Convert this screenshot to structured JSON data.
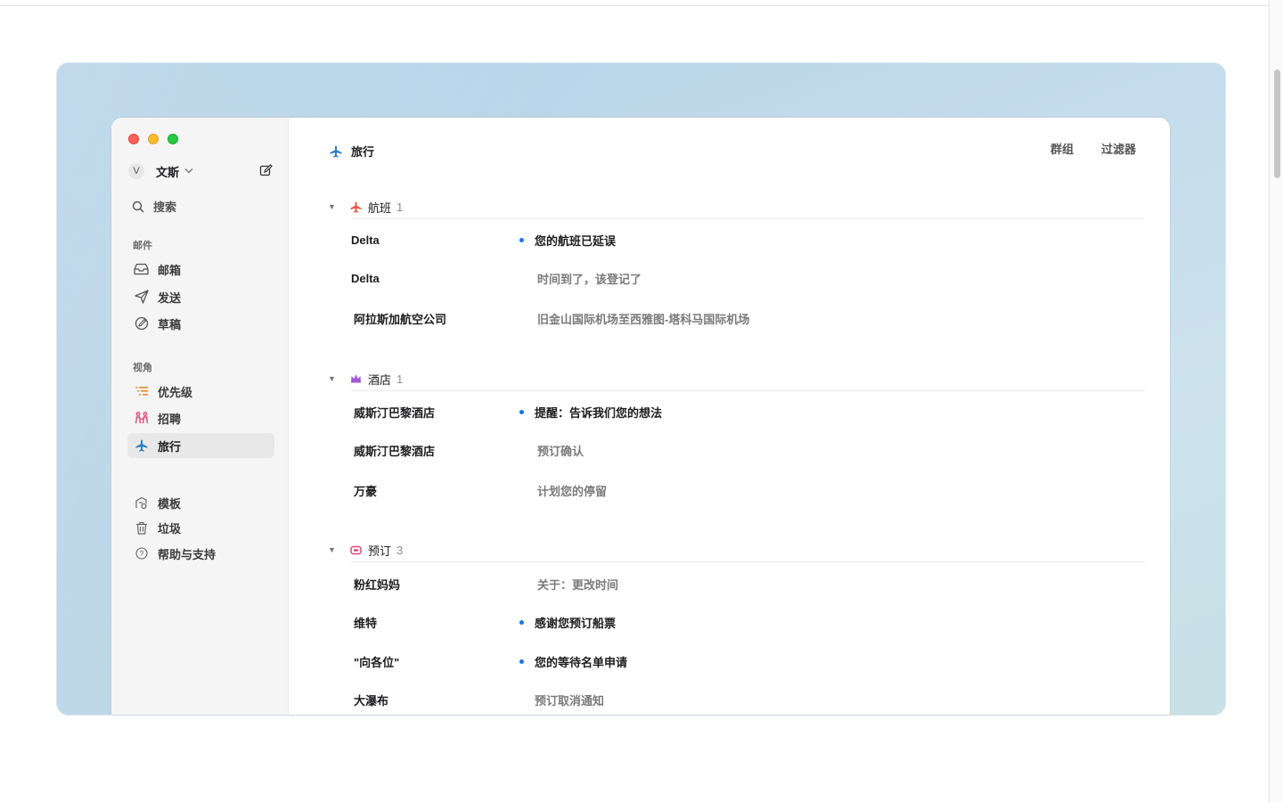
{
  "sidebar": {
    "account": {
      "initial": "V",
      "name": "文斯"
    },
    "search_label": "搜索",
    "mail_section": "邮件",
    "mail_items": [
      {
        "label": "邮箱",
        "icon": "inbox-icon"
      },
      {
        "label": "发送",
        "icon": "send-icon"
      },
      {
        "label": "草稿",
        "icon": "draft-icon"
      }
    ],
    "views_section": "视角",
    "view_items": [
      {
        "label": "优先级",
        "icon": "priority-list-icon"
      },
      {
        "label": "招聘",
        "icon": "people-icon"
      },
      {
        "label": "旅行",
        "icon": "airplane-icon",
        "active": true
      }
    ],
    "bottom_items": [
      {
        "label": "模板",
        "icon": "template-icon"
      },
      {
        "label": "垃圾",
        "icon": "trash-icon"
      },
      {
        "label": "帮助与支持",
        "icon": "help-icon"
      }
    ]
  },
  "main": {
    "title": "旅行",
    "group_button": "群组",
    "filter_button": "过滤器",
    "groups": [
      {
        "name": "航班",
        "count": "1",
        "icon": "airplane-icon",
        "color": "#e8503a",
        "rows": [
          {
            "sender": "Delta",
            "subject": "您的航班已延误",
            "unread": true
          },
          {
            "sender": "Delta",
            "subject": "时间到了，该登记了",
            "unread": false
          },
          {
            "sender": "阿拉斯加航空公司",
            "subject": "旧金山国际机场至西雅图-塔科马国际机场",
            "unread": false
          }
        ]
      },
      {
        "name": "酒店",
        "count": "1",
        "icon": "crown-icon",
        "color": "#a157d6",
        "rows": [
          {
            "sender": "威斯汀巴黎酒店",
            "subject": "提醒：告诉我们您的想法",
            "unread": true
          },
          {
            "sender": "威斯汀巴黎酒店",
            "subject": "预订确认",
            "unread": false
          },
          {
            "sender": "万豪",
            "subject": "计划您的停留",
            "unread": false
          }
        ]
      },
      {
        "name": "预订",
        "count": "3",
        "icon": "ticket-icon",
        "color": "#e0457b",
        "rows": [
          {
            "sender": "粉红妈妈",
            "subject": "关于：更改时间",
            "unread": false
          },
          {
            "sender": "维特",
            "subject": "感谢您预订船票",
            "unread": true
          },
          {
            "sender": "\"向各位\"",
            "subject": "您的等待名单申请",
            "unread": true
          },
          {
            "sender": "大瀑布",
            "subject": "预订取消通知",
            "unread": false
          }
        ]
      }
    ]
  },
  "colors": {
    "accent_dot": "#1b73e8",
    "travel_icon": "#2f7fc1",
    "priority_icon": "#e8892a",
    "people_icon": "#e0457b"
  }
}
